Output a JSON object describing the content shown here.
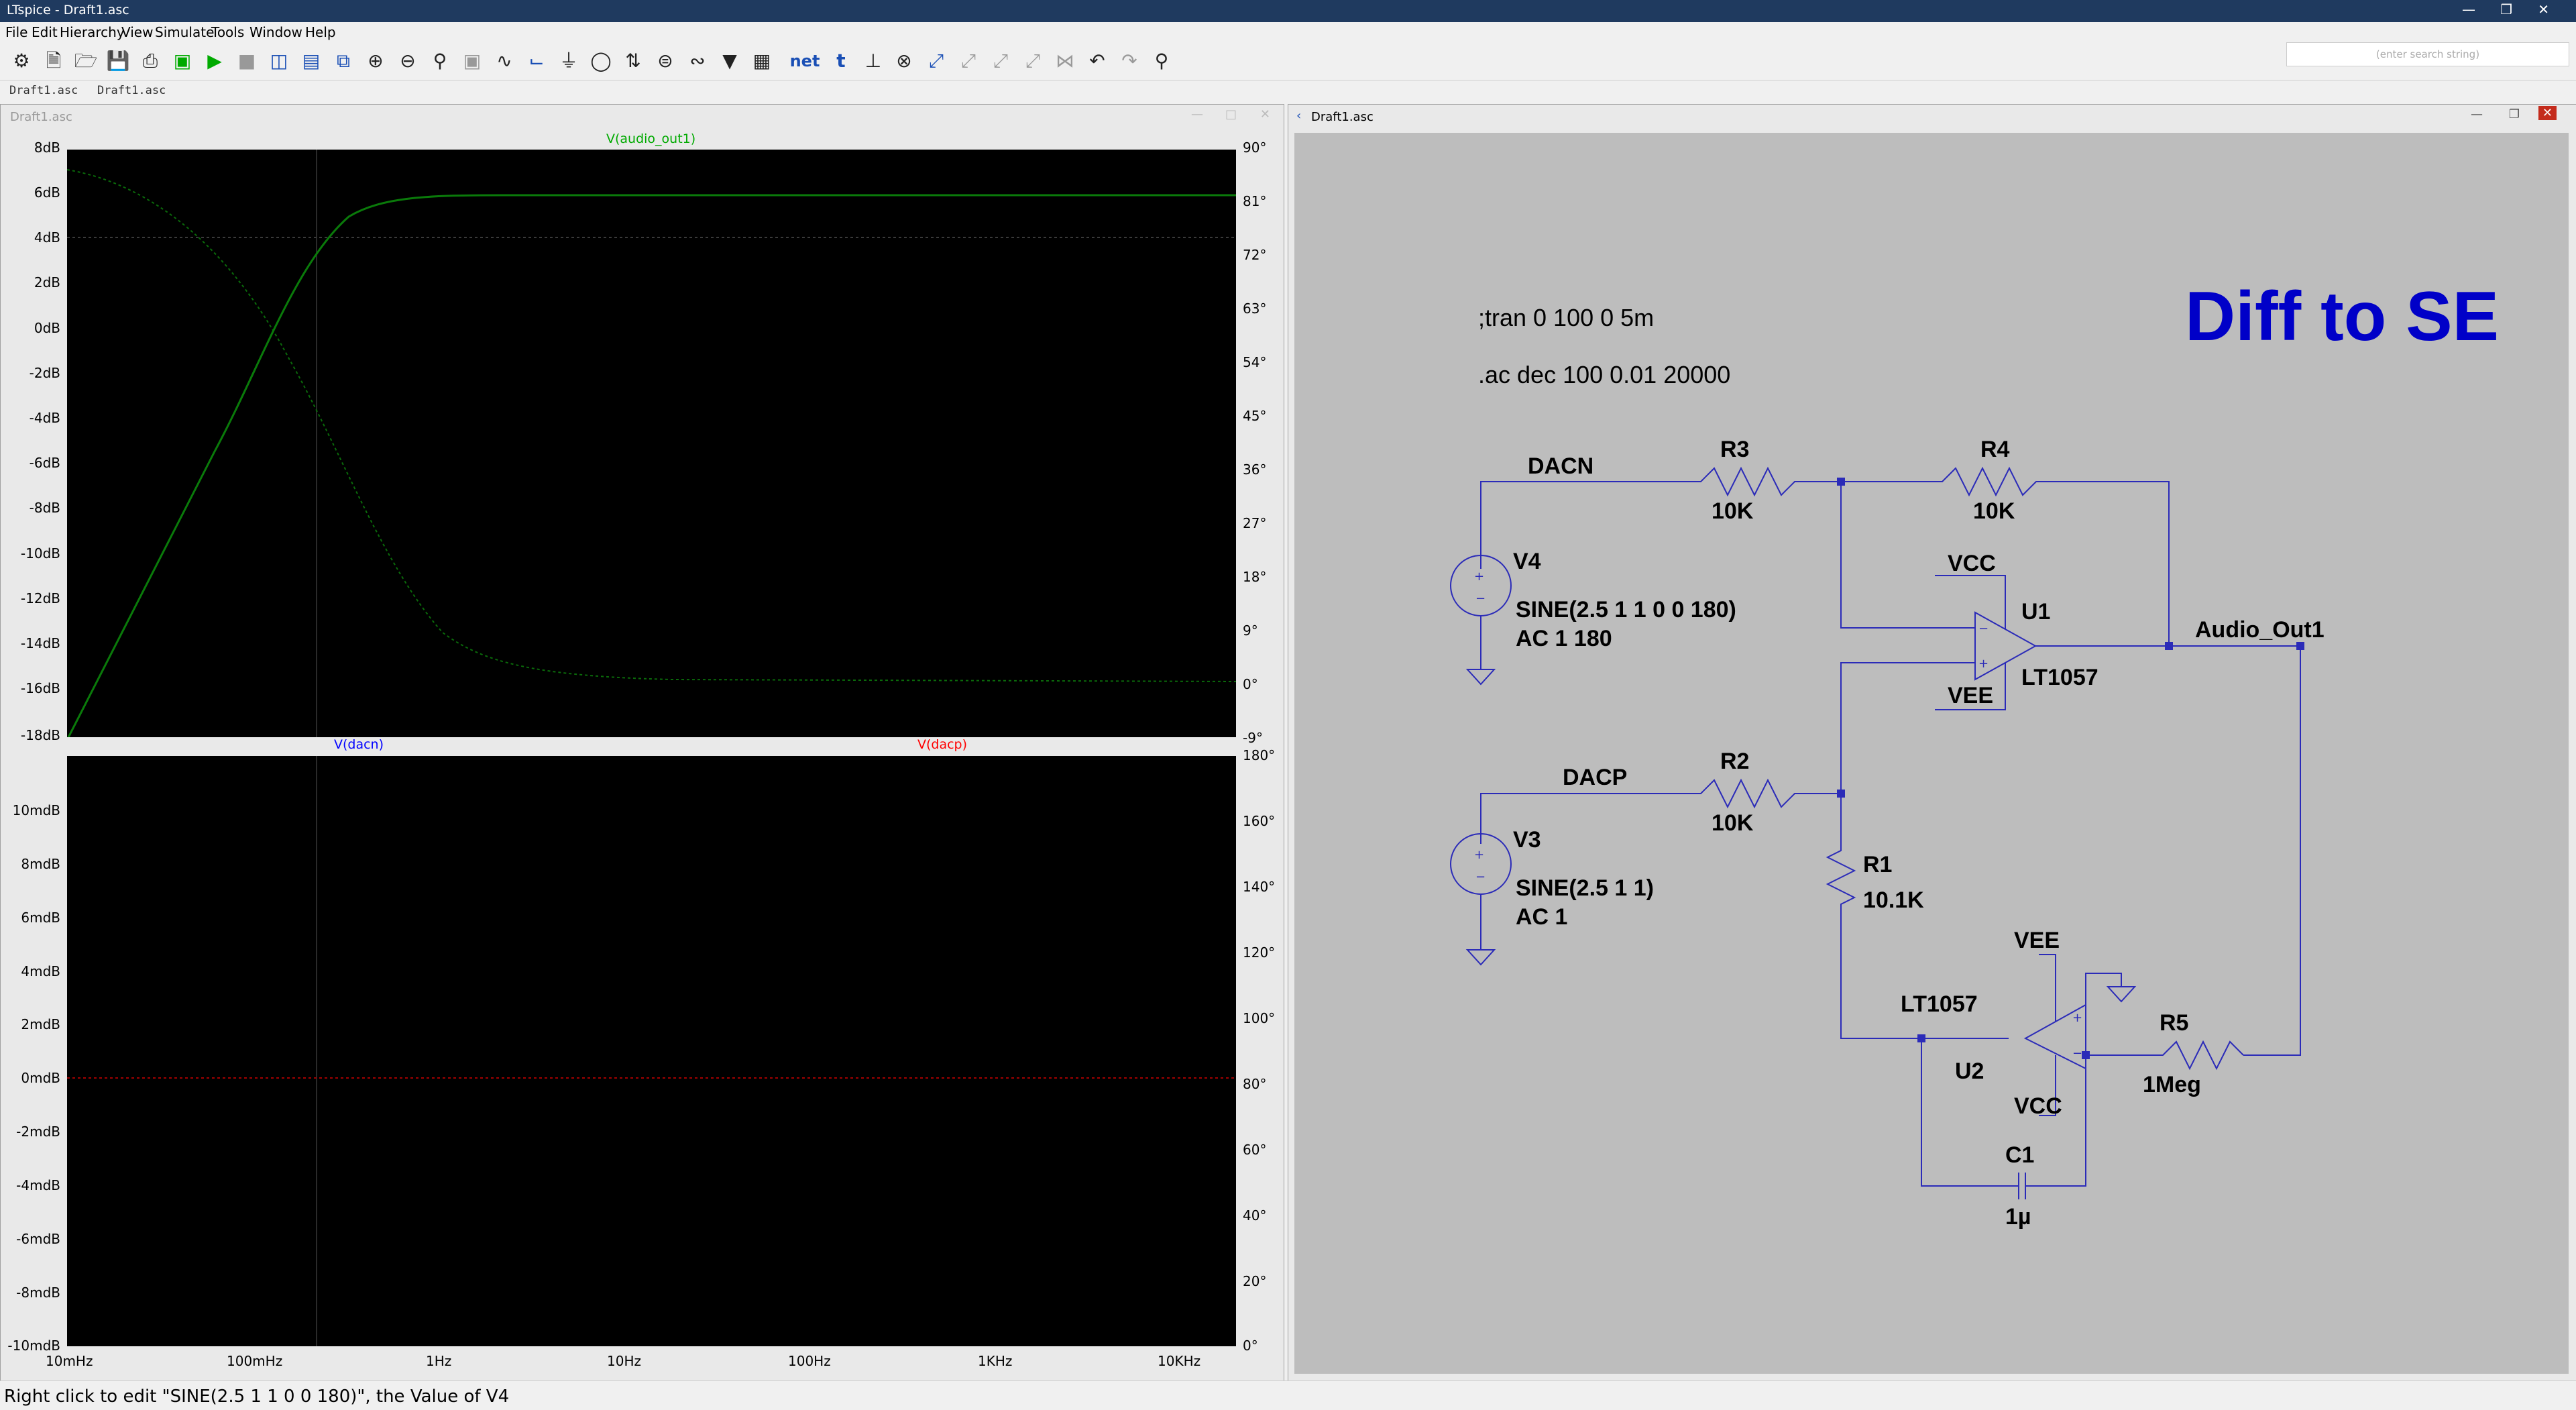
{
  "window": {
    "title": "LTspice - Draft1.asc"
  },
  "menu": [
    "File",
    "Edit",
    "Hierarchy",
    "View",
    "Simulate",
    "Tools",
    "Window",
    "Help"
  ],
  "toolbar": {
    "icons": [
      "gear-icon",
      "open-icon",
      "folder-icon",
      "save-icon",
      "print-icon",
      "chip-icon",
      "run-icon",
      "halt-icon",
      "tile-vertical-icon",
      "tile-horizontal-icon",
      "cascade-icon",
      "zoom-in-icon",
      "zoom-out-icon",
      "zoom-fit-icon",
      "zoom-cancel-icon",
      "autorange-icon",
      "wire-icon",
      "ground-icon",
      "label-icon",
      "resistor-icon",
      "capacitor-icon",
      "inductor-icon",
      "diode-icon",
      "component-icon",
      "net-icon",
      "text-icon",
      "spice-directive-icon",
      "delete-icon",
      "duplicate-icon",
      "move-icon",
      "drag-icon",
      "rotate-icon",
      "mirror-icon",
      "undo-icon",
      "redo-icon",
      "find-icon"
    ],
    "net_label": "net",
    "text_label": "t",
    "search_placeholder": "(enter search string)"
  },
  "tabs": [
    "Draft1.asc",
    "Draft1.asc"
  ],
  "left_window": {
    "title": "Draft1.asc"
  },
  "right_window": {
    "title": "Draft1.asc"
  },
  "waveform_top": {
    "trace_label": "V(audio_out1)",
    "trace_color": "#00ff00",
    "y_ticks": [
      "8dB",
      "6dB",
      "4dB",
      "2dB",
      "0dB",
      "-2dB",
      "-4dB",
      "-6dB",
      "-8dB",
      "-10dB",
      "-12dB",
      "-14dB",
      "-16dB",
      "-18dB"
    ],
    "y2_ticks": [
      "90°",
      "81°",
      "72°",
      "63°",
      "54°",
      "45°",
      "36°",
      "27°",
      "18°",
      "9°",
      "0°",
      "-9°"
    ]
  },
  "waveform_bottom": {
    "trace_labels": [
      {
        "text": "V(dacn)",
        "color": "#0000ff"
      },
      {
        "text": "V(dacp)",
        "color": "#ff0000"
      }
    ],
    "y_ticks": [
      "10mdB",
      "8mdB",
      "6mdB",
      "4mdB",
      "2mdB",
      "0mdB",
      "-2mdB",
      "-4mdB",
      "-6mdB",
      "-8mdB",
      "-10mdB"
    ],
    "y2_ticks": [
      "180°",
      "160°",
      "140°",
      "120°",
      "100°",
      "80°",
      "60°",
      "40°",
      "20°",
      "0°"
    ],
    "x_ticks": [
      "10mHz",
      "100mHz",
      "1Hz",
      "10Hz",
      "100Hz",
      "1KHz",
      "10KHz"
    ]
  },
  "schematic": {
    "title": "Diff to SE",
    "title_color": "#0000c8",
    "directives": [
      ";tran 0 100 0 5m",
      ".ac dec 100 0.01 20000"
    ],
    "labels": {
      "dacn": "DACN",
      "dacp": "DACP",
      "r3": "R3",
      "r3v": "10K",
      "r4": "R4",
      "r4v": "10K",
      "r2": "R2",
      "r2v": "10K",
      "r1": "R1",
      "r1v": "10.1K",
      "r5": "R5",
      "r5v": "1Meg",
      "c1": "C1",
      "c1v": "1µ",
      "v4": "V4",
      "v4v": "SINE(2.5 1 1 0 0 180)",
      "v4ac": "AC 1 180",
      "v3": "V3",
      "v3v": "SINE(2.5 1 1)",
      "v3ac": "AC 1",
      "u1": "U1",
      "u1m": "LT1057",
      "u2": "U2",
      "u2m": "LT1057",
      "vcc1": "VCC",
      "vee1": "VEE",
      "vee2": "VEE",
      "vcc2": "VCC",
      "out": "Audio_Out1"
    }
  },
  "status": "Right click to edit \"SINE(2.5 1 1 0 0 180)\", the Value of V4"
}
